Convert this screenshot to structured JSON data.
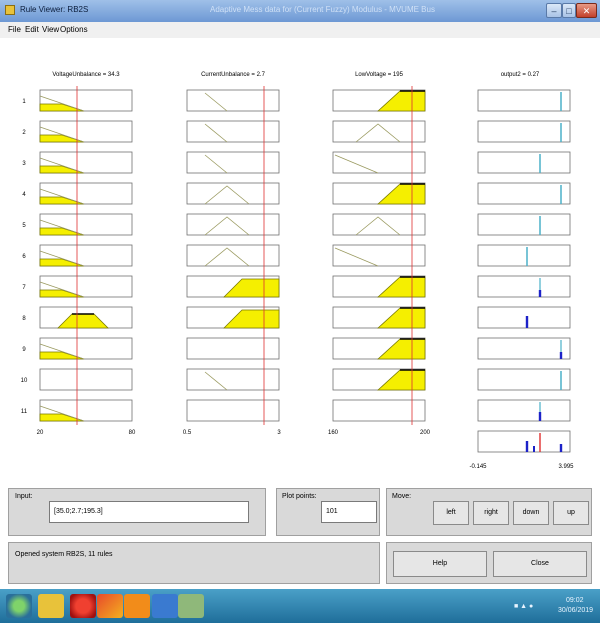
{
  "window": {
    "title": "Rule Viewer: RB2S",
    "title_center": "Adaptive Mess data for (Current Fuzzy) Modulus - MVUME Bus"
  },
  "menu": [
    "File",
    "Edit",
    "View",
    "Options"
  ],
  "inputs": [
    {
      "label": "VoltageUnbalance = 34.3",
      "axis_min": "20",
      "axis_max": "80"
    },
    {
      "label": "CurrentUnbalance = 2.7",
      "axis_min": "0.5",
      "axis_max": "3"
    },
    {
      "label": "LowVoltage = 195",
      "axis_min": "160",
      "axis_max": "200"
    }
  ],
  "output": {
    "label": "output2 = 0.27",
    "axis_min": "-0.145",
    "axis_max": "3.995"
  },
  "rule_numbers": [
    "1",
    "2",
    "3",
    "4",
    "5",
    "6",
    "7",
    "8",
    "9",
    "10",
    "11"
  ],
  "controls": {
    "input_label": "Input:",
    "input_value": "[35.0;2.7;195.3]",
    "plot_points_label": "Plot points:",
    "plot_points_value": "101",
    "move_label": "Move:",
    "move_buttons": [
      "left",
      "right",
      "down",
      "up"
    ],
    "status": "Opened system RB2S, 11 rules",
    "help": "Help",
    "close": "Close"
  },
  "taskbar": {
    "time": "09:02",
    "date": "30/06/2019"
  },
  "colors": {
    "fill": "#f5ef00",
    "line_red": "#e03030",
    "line_cyan": "#4ab0c8",
    "line_blue": "#1c22c8"
  }
}
